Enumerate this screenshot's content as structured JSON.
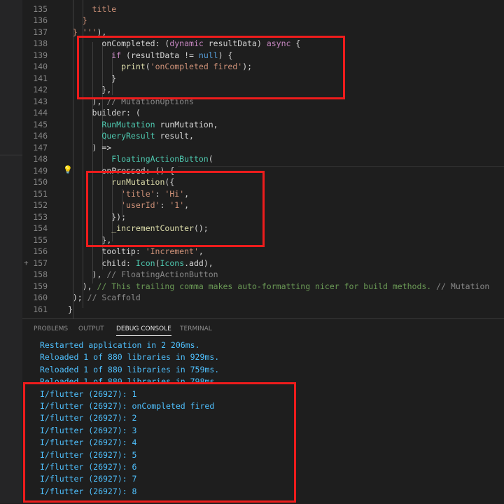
{
  "editor": {
    "lines": [
      {
        "num": "135",
        "indent": "      ",
        "tokens": [
          {
            "t": "title",
            "c": "st"
          }
        ]
      },
      {
        "num": "136",
        "indent": "    ",
        "tokens": [
          {
            "t": "}",
            "c": "st"
          }
        ]
      },
      {
        "num": "137",
        "indent": "  ",
        "tokens": [
          {
            "t": "} '''",
            "c": "st"
          },
          {
            "t": "),",
            "c": ""
          }
        ]
      },
      {
        "num": "138",
        "indent": "        ",
        "tokens": [
          {
            "t": "onCompleted: (",
            "c": ""
          },
          {
            "t": "dynamic",
            "c": "kw"
          },
          {
            "t": " resultData) ",
            "c": ""
          },
          {
            "t": "async",
            "c": "kw"
          },
          {
            "t": " {",
            "c": ""
          }
        ]
      },
      {
        "num": "139",
        "indent": "          ",
        "tokens": [
          {
            "t": "if",
            "c": "kw"
          },
          {
            "t": " (resultData != ",
            "c": ""
          },
          {
            "t": "null",
            "c": "kb"
          },
          {
            "t": ") {",
            "c": ""
          }
        ]
      },
      {
        "num": "140",
        "indent": "            ",
        "tokens": [
          {
            "t": "print",
            "c": "fn"
          },
          {
            "t": "(",
            "c": ""
          },
          {
            "t": "'onCompleted fired'",
            "c": "st"
          },
          {
            "t": ");",
            "c": ""
          }
        ]
      },
      {
        "num": "141",
        "indent": "          ",
        "tokens": [
          {
            "t": "}",
            "c": ""
          }
        ]
      },
      {
        "num": "142",
        "indent": "        ",
        "tokens": [
          {
            "t": "},",
            "c": ""
          }
        ]
      },
      {
        "num": "143",
        "indent": "      ",
        "tokens": [
          {
            "t": "), ",
            "c": ""
          },
          {
            "t": "// MutationOptions",
            "c": "gy"
          }
        ]
      },
      {
        "num": "144",
        "indent": "      ",
        "tokens": [
          {
            "t": "builder: (",
            "c": ""
          }
        ]
      },
      {
        "num": "145",
        "indent": "        ",
        "tokens": [
          {
            "t": "RunMutation",
            "c": "ty"
          },
          {
            "t": " runMutation,",
            "c": ""
          }
        ]
      },
      {
        "num": "146",
        "indent": "        ",
        "tokens": [
          {
            "t": "QueryResult",
            "c": "ty"
          },
          {
            "t": " result,",
            "c": ""
          }
        ]
      },
      {
        "num": "147",
        "indent": "      ",
        "tokens": [
          {
            "t": ") =>",
            "c": ""
          }
        ]
      },
      {
        "num": "148",
        "indent": "          ",
        "tokens": [
          {
            "t": "FloatingActionButton",
            "c": "ty"
          },
          {
            "t": "(",
            "c": ""
          }
        ]
      },
      {
        "num": "149",
        "indent": "        ",
        "tokens": [
          {
            "t": "onPressed: () {",
            "c": ""
          }
        ]
      },
      {
        "num": "150",
        "indent": "          ",
        "tokens": [
          {
            "t": "runMutation",
            "c": "fn"
          },
          {
            "t": "({",
            "c": ""
          }
        ]
      },
      {
        "num": "151",
        "indent": "            ",
        "tokens": [
          {
            "t": "'title'",
            "c": "st"
          },
          {
            "t": ": ",
            "c": ""
          },
          {
            "t": "'Hi'",
            "c": "st"
          },
          {
            "t": ",",
            "c": ""
          }
        ]
      },
      {
        "num": "152",
        "indent": "            ",
        "tokens": [
          {
            "t": "'userId'",
            "c": "st"
          },
          {
            "t": ": ",
            "c": ""
          },
          {
            "t": "'1'",
            "c": "st"
          },
          {
            "t": ",",
            "c": ""
          }
        ]
      },
      {
        "num": "153",
        "indent": "          ",
        "tokens": [
          {
            "t": "});",
            "c": ""
          }
        ]
      },
      {
        "num": "154",
        "indent": "          ",
        "tokens": [
          {
            "t": "_incrementCounter",
            "c": "fn"
          },
          {
            "t": "();",
            "c": ""
          }
        ]
      },
      {
        "num": "155",
        "indent": "        ",
        "tokens": [
          {
            "t": "},",
            "c": ""
          }
        ]
      },
      {
        "num": "156",
        "indent": "        ",
        "tokens": [
          {
            "t": "tooltip: ",
            "c": ""
          },
          {
            "t": "'Increment'",
            "c": "st"
          },
          {
            "t": ",",
            "c": ""
          }
        ]
      },
      {
        "num": "157",
        "indent": "        ",
        "tokens": [
          {
            "t": "child: ",
            "c": ""
          },
          {
            "t": "Icon",
            "c": "ty"
          },
          {
            "t": "(",
            "c": ""
          },
          {
            "t": "Icons",
            "c": "ty"
          },
          {
            "t": ".add),",
            "c": ""
          }
        ]
      },
      {
        "num": "158",
        "indent": "      ",
        "tokens": [
          {
            "t": "), ",
            "c": ""
          },
          {
            "t": "// FloatingActionButton",
            "c": "gy"
          }
        ]
      },
      {
        "num": "159",
        "indent": "    ",
        "tokens": [
          {
            "t": "), ",
            "c": ""
          },
          {
            "t": "// This trailing comma makes auto-formatting nicer for build methods.",
            "c": "cm"
          },
          {
            "t": " // Mutation",
            "c": "gy"
          }
        ]
      },
      {
        "num": "160",
        "indent": "  ",
        "tokens": [
          {
            "t": "); ",
            "c": ""
          },
          {
            "t": "// Scaffold",
            "c": "gy"
          }
        ]
      },
      {
        "num": "161",
        "indent": " ",
        "tokens": [
          {
            "t": "}",
            "c": ""
          }
        ]
      }
    ],
    "gutter_marker": "+",
    "gutter_marker_line": "157",
    "lightbulb_line": "149"
  },
  "panel": {
    "tabs": [
      {
        "label": "PROBLEMS",
        "active": false
      },
      {
        "label": "OUTPUT",
        "active": false
      },
      {
        "label": "DEBUG CONSOLE",
        "active": true
      },
      {
        "label": "TERMINAL",
        "active": false
      }
    ],
    "output": [
      "Restarted application in 2 206ms.",
      "Reloaded 1 of 880 libraries in 929ms.",
      "Reloaded 1 of 880 libraries in 759ms.",
      "Reloaded 1 of 880 libraries in 798ms.",
      "I/flutter (26927): 1",
      "I/flutter (26927): onCompleted fired",
      "I/flutter (26927): 2",
      "I/flutter (26927): 3",
      "I/flutter (26927): 4",
      "I/flutter (26927): 5",
      "I/flutter (26927): 6",
      "I/flutter (26927): 7",
      "I/flutter (26927): 8"
    ]
  },
  "colors": {
    "highlight": "#ee1c1c",
    "console_text": "#4fc1ff",
    "background": "#1e1e1e"
  }
}
